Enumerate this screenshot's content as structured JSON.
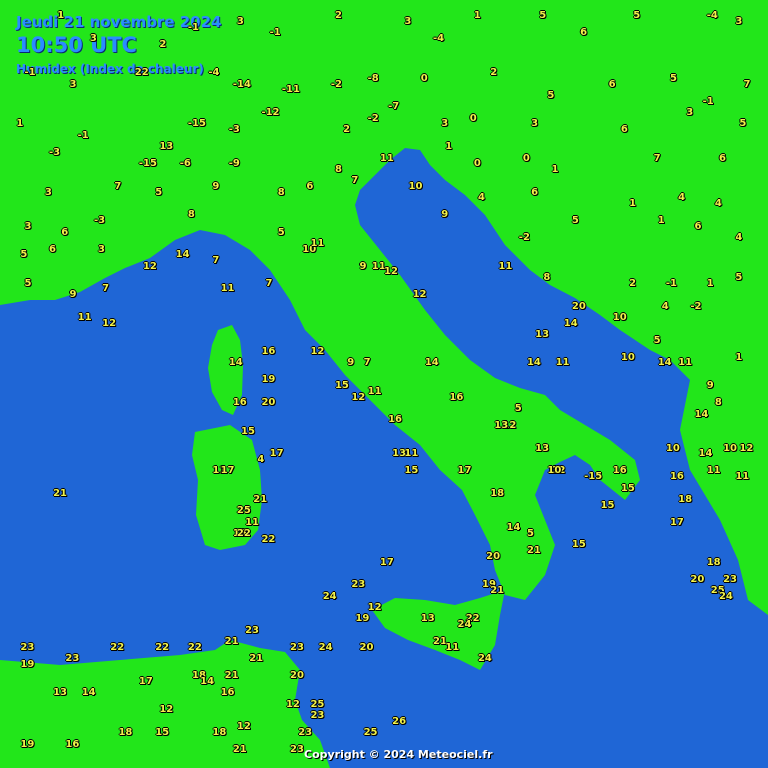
{
  "header": {
    "date": "Jeudi 21 novembre 2024",
    "time": "10:50 UTC",
    "product": "Humidex (Index de chaleur)"
  },
  "copyright": "Copyright © 2024 Meteociel.fr",
  "colors": {
    "sea": "#1f66d6",
    "land": "#22e61a",
    "value_text": "#f2f24a",
    "header_text": "#2a8cff"
  },
  "stations": [
    {
      "v": "1",
      "lon": 4.4,
      "lat": 47.9
    },
    {
      "v": "3",
      "lon": 5.2,
      "lat": 47.5
    },
    {
      "v": "2",
      "lon": 6.9,
      "lat": 47.4
    },
    {
      "v": "-1",
      "lon": 7.6,
      "lat": 47.7
    },
    {
      "v": "3",
      "lon": 8.8,
      "lat": 47.8
    },
    {
      "v": "-1",
      "lon": 9.6,
      "lat": 47.6
    },
    {
      "v": "2",
      "lon": 11.2,
      "lat": 47.9
    },
    {
      "v": "3",
      "lon": 12.9,
      "lat": 47.8
    },
    {
      "v": "-4",
      "lon": 13.6,
      "lat": 47.5
    },
    {
      "v": "1",
      "lon": 14.6,
      "lat": 47.9
    },
    {
      "v": "5",
      "lon": 16.2,
      "lat": 47.9
    },
    {
      "v": "6",
      "lon": 17.2,
      "lat": 47.6
    },
    {
      "v": "5",
      "lon": 18.5,
      "lat": 47.9
    },
    {
      "v": "-4",
      "lon": 20.3,
      "lat": 47.9
    },
    {
      "v": "3",
      "lon": 21.0,
      "lat": 47.8
    },
    {
      "v": "-1",
      "lon": 3.6,
      "lat": 46.9
    },
    {
      "v": "3",
      "lon": 4.7,
      "lat": 46.7
    },
    {
      "v": "22",
      "lon": 6.3,
      "lat": 46.9
    },
    {
      "v": "-4",
      "lon": 8.1,
      "lat": 46.9
    },
    {
      "v": "-14",
      "lon": 8.7,
      "lat": 46.7
    },
    {
      "v": "-11",
      "lon": 9.9,
      "lat": 46.6
    },
    {
      "v": "-2",
      "lon": 11.1,
      "lat": 46.7
    },
    {
      "v": "-8",
      "lon": 12.0,
      "lat": 46.8
    },
    {
      "v": "0",
      "lon": 13.3,
      "lat": 46.8
    },
    {
      "v": "2",
      "lon": 15.0,
      "lat": 46.9
    },
    {
      "v": "5",
      "lon": 16.4,
      "lat": 46.5
    },
    {
      "v": "6",
      "lon": 17.9,
      "lat": 46.7
    },
    {
      "v": "5",
      "lon": 19.4,
      "lat": 46.8
    },
    {
      "v": "-1",
      "lon": 20.2,
      "lat": 46.4
    },
    {
      "v": "7",
      "lon": 21.2,
      "lat": 46.7
    },
    {
      "v": "1",
      "lon": 3.4,
      "lat": 46.0
    },
    {
      "v": "-1",
      "lon": 4.9,
      "lat": 45.8
    },
    {
      "v": "13",
      "lon": 6.9,
      "lat": 45.6
    },
    {
      "v": "-15",
      "lon": 7.6,
      "lat": 46.0
    },
    {
      "v": "-3",
      "lon": 8.6,
      "lat": 45.9
    },
    {
      "v": "-12",
      "lon": 9.4,
      "lat": 46.2
    },
    {
      "v": "2",
      "lon": 11.4,
      "lat": 45.9
    },
    {
      "v": "-2",
      "lon": 12.0,
      "lat": 46.1
    },
    {
      "v": "-7",
      "lon": 12.5,
      "lat": 46.3
    },
    {
      "v": "3",
      "lon": 13.8,
      "lat": 46.0
    },
    {
      "v": "0",
      "lon": 14.5,
      "lat": 46.1
    },
    {
      "v": "3",
      "lon": 16.0,
      "lat": 46.0
    },
    {
      "v": "6",
      "lon": 18.2,
      "lat": 45.9
    },
    {
      "v": "3",
      "lon": 19.8,
      "lat": 46.2
    },
    {
      "v": "5",
      "lon": 21.1,
      "lat": 46.0
    },
    {
      "v": "-3",
      "lon": 4.2,
      "lat": 45.5
    },
    {
      "v": "-15",
      "lon": 6.4,
      "lat": 45.3
    },
    {
      "v": "-6",
      "lon": 7.4,
      "lat": 45.3
    },
    {
      "v": "-9",
      "lon": 8.6,
      "lat": 45.3
    },
    {
      "v": "8",
      "lon": 11.2,
      "lat": 45.2
    },
    {
      "v": "11",
      "lon": 12.3,
      "lat": 45.4
    },
    {
      "v": "1",
      "lon": 13.9,
      "lat": 45.6
    },
    {
      "v": "0",
      "lon": 14.6,
      "lat": 45.3
    },
    {
      "v": "0",
      "lon": 15.8,
      "lat": 45.4
    },
    {
      "v": "1",
      "lon": 16.5,
      "lat": 45.2
    },
    {
      "v": "7",
      "lon": 19.0,
      "lat": 45.4
    },
    {
      "v": "6",
      "lon": 20.6,
      "lat": 45.4
    },
    {
      "v": "3",
      "lon": 4.1,
      "lat": 44.8
    },
    {
      "v": "7",
      "lon": 5.8,
      "lat": 44.9
    },
    {
      "v": "5",
      "lon": 6.8,
      "lat": 44.8
    },
    {
      "v": "9",
      "lon": 8.2,
      "lat": 44.9
    },
    {
      "v": "8",
      "lon": 9.8,
      "lat": 44.8
    },
    {
      "v": "6",
      "lon": 10.5,
      "lat": 44.9
    },
    {
      "v": "7",
      "lon": 11.6,
      "lat": 45.0
    },
    {
      "v": "10",
      "lon": 13.0,
      "lat": 44.9
    },
    {
      "v": "4",
      "lon": 14.7,
      "lat": 44.7
    },
    {
      "v": "6",
      "lon": 16.0,
      "lat": 44.8
    },
    {
      "v": "1",
      "lon": 18.4,
      "lat": 44.6
    },
    {
      "v": "4",
      "lon": 19.6,
      "lat": 44.7
    },
    {
      "v": "4",
      "lon": 20.5,
      "lat": 44.6
    },
    {
      "v": "3",
      "lon": 3.6,
      "lat": 44.2
    },
    {
      "v": "6",
      "lon": 4.5,
      "lat": 44.1
    },
    {
      "v": "-3",
      "lon": 5.3,
      "lat": 44.3
    },
    {
      "v": "8",
      "lon": 7.6,
      "lat": 44.4
    },
    {
      "v": "5",
      "lon": 9.8,
      "lat": 44.1
    },
    {
      "v": "9",
      "lon": 13.8,
      "lat": 44.4
    },
    {
      "v": "-2",
      "lon": 15.7,
      "lat": 44.0
    },
    {
      "v": "5",
      "lon": 17.0,
      "lat": 44.3
    },
    {
      "v": "1",
      "lon": 19.1,
      "lat": 44.3
    },
    {
      "v": "6",
      "lon": 20.0,
      "lat": 44.2
    },
    {
      "v": "4",
      "lon": 21.0,
      "lat": 44.0
    },
    {
      "v": "5",
      "lon": 3.5,
      "lat": 43.7
    },
    {
      "v": "6",
      "lon": 4.2,
      "lat": 43.8
    },
    {
      "v": "3",
      "lon": 5.4,
      "lat": 43.8
    },
    {
      "v": "14",
      "lon": 7.3,
      "lat": 43.7
    },
    {
      "v": "7",
      "lon": 8.2,
      "lat": 43.6
    },
    {
      "v": "10",
      "lon": 10.4,
      "lat": 43.8
    },
    {
      "v": "11",
      "lon": 10.6,
      "lat": 43.9
    },
    {
      "v": "9",
      "lon": 11.8,
      "lat": 43.5
    },
    {
      "v": "11",
      "lon": 12.1,
      "lat": 43.5
    },
    {
      "v": "11",
      "lon": 15.2,
      "lat": 43.5
    },
    {
      "v": "2",
      "lon": 18.4,
      "lat": 43.2
    },
    {
      "v": "-1",
      "lon": 19.3,
      "lat": 43.2
    },
    {
      "v": "1",
      "lon": 20.3,
      "lat": 43.2
    },
    {
      "v": "5",
      "lon": 21.0,
      "lat": 43.3
    },
    {
      "v": "5",
      "lon": 3.6,
      "lat": 43.2
    },
    {
      "v": "9",
      "lon": 4.7,
      "lat": 43.0
    },
    {
      "v": "7",
      "lon": 5.5,
      "lat": 43.1
    },
    {
      "v": "12",
      "lon": 6.5,
      "lat": 43.5
    },
    {
      "v": "11",
      "lon": 8.4,
      "lat": 43.1
    },
    {
      "v": "7",
      "lon": 9.5,
      "lat": 43.2
    },
    {
      "v": "12",
      "lon": 12.4,
      "lat": 43.4
    },
    {
      "v": "12",
      "lon": 13.1,
      "lat": 43.0
    },
    {
      "v": "8",
      "lon": 16.3,
      "lat": 43.3
    },
    {
      "v": "20",
      "lon": 17.0,
      "lat": 42.8
    },
    {
      "v": "4",
      "lon": 19.2,
      "lat": 42.8
    },
    {
      "v": "-2",
      "lon": 19.9,
      "lat": 42.8
    },
    {
      "v": "11",
      "lon": 4.9,
      "lat": 42.6
    },
    {
      "v": "12",
      "lon": 5.5,
      "lat": 42.5
    },
    {
      "v": "13",
      "lon": 16.1,
      "lat": 42.3
    },
    {
      "v": "14",
      "lon": 16.8,
      "lat": 42.5
    },
    {
      "v": "10",
      "lon": 18.0,
      "lat": 42.6
    },
    {
      "v": "5",
      "lon": 19.0,
      "lat": 42.2
    },
    {
      "v": "14",
      "lon": 8.6,
      "lat": 41.8
    },
    {
      "v": "16",
      "lon": 9.4,
      "lat": 42.0
    },
    {
      "v": "12",
      "lon": 10.6,
      "lat": 42.0
    },
    {
      "v": "9",
      "lon": 11.5,
      "lat": 41.8
    },
    {
      "v": "7",
      "lon": 11.9,
      "lat": 41.8
    },
    {
      "v": "14",
      "lon": 13.4,
      "lat": 41.8
    },
    {
      "v": "14",
      "lon": 15.9,
      "lat": 41.8
    },
    {
      "v": "11",
      "lon": 16.6,
      "lat": 41.8
    },
    {
      "v": "10",
      "lon": 18.2,
      "lat": 41.9
    },
    {
      "v": "14",
      "lon": 19.1,
      "lat": 41.8
    },
    {
      "v": "11",
      "lon": 19.6,
      "lat": 41.8
    },
    {
      "v": "1",
      "lon": 21.0,
      "lat": 41.9
    },
    {
      "v": "19",
      "lon": 9.4,
      "lat": 41.5
    },
    {
      "v": "16",
      "lon": 8.7,
      "lat": 41.1
    },
    {
      "v": "20",
      "lon": 9.4,
      "lat": 41.1
    },
    {
      "v": "15",
      "lon": 11.2,
      "lat": 41.4
    },
    {
      "v": "12",
      "lon": 11.6,
      "lat": 41.2
    },
    {
      "v": "11",
      "lon": 12.0,
      "lat": 41.3
    },
    {
      "v": "16",
      "lon": 14.0,
      "lat": 41.2
    },
    {
      "v": "5",
      "lon": 15.6,
      "lat": 41.0
    },
    {
      "v": "9",
      "lon": 20.3,
      "lat": 41.4
    },
    {
      "v": "15",
      "lon": 8.9,
      "lat": 40.6
    },
    {
      "v": "16",
      "lon": 12.5,
      "lat": 40.8
    },
    {
      "v": "12",
      "lon": 15.3,
      "lat": 40.7
    },
    {
      "v": "13",
      "lon": 15.1,
      "lat": 40.7
    },
    {
      "v": "14",
      "lon": 20.0,
      "lat": 40.9
    },
    {
      "v": "8",
      "lon": 20.5,
      "lat": 41.1
    },
    {
      "v": "4",
      "lon": 9.3,
      "lat": 40.1
    },
    {
      "v": "17",
      "lon": 9.6,
      "lat": 40.2
    },
    {
      "v": "13",
      "lon": 12.6,
      "lat": 40.2
    },
    {
      "v": "11",
      "lon": 12.9,
      "lat": 40.2
    },
    {
      "v": "15",
      "lon": 12.9,
      "lat": 39.9
    },
    {
      "v": "17",
      "lon": 14.2,
      "lat": 39.9
    },
    {
      "v": "13",
      "lon": 16.1,
      "lat": 40.3
    },
    {
      "v": "12",
      "lon": 16.5,
      "lat": 39.9
    },
    {
      "v": "10",
      "lon": 16.4,
      "lat": 39.9
    },
    {
      "v": "-15",
      "lon": 17.3,
      "lat": 39.8
    },
    {
      "v": "16",
      "lon": 18.0,
      "lat": 39.9
    },
    {
      "v": "10",
      "lon": 19.3,
      "lat": 40.3
    },
    {
      "v": "14",
      "lon": 20.1,
      "lat": 40.2
    },
    {
      "v": "10",
      "lon": 20.7,
      "lat": 40.3
    },
    {
      "v": "12",
      "lon": 21.1,
      "lat": 40.3
    },
    {
      "v": "11",
      "lon": 8.2,
      "lat": 39.9
    },
    {
      "v": "17",
      "lon": 8.4,
      "lat": 39.9
    },
    {
      "v": "15",
      "lon": 18.2,
      "lat": 39.6
    },
    {
      "v": "16",
      "lon": 19.4,
      "lat": 39.8
    },
    {
      "v": "11",
      "lon": 20.3,
      "lat": 39.9
    },
    {
      "v": "11",
      "lon": 21.0,
      "lat": 39.8
    },
    {
      "v": "21",
      "lon": 4.3,
      "lat": 39.5
    },
    {
      "v": "21",
      "lon": 9.2,
      "lat": 39.4
    },
    {
      "v": "25",
      "lon": 8.8,
      "lat": 39.2
    },
    {
      "v": "11",
      "lon": 9.0,
      "lat": 39.0
    },
    {
      "v": "19",
      "lon": 8.7,
      "lat": 38.8
    },
    {
      "v": "22",
      "lon": 8.8,
      "lat": 38.8
    },
    {
      "v": "22",
      "lon": 9.4,
      "lat": 38.7
    },
    {
      "v": "18",
      "lon": 15.0,
      "lat": 39.5
    },
    {
      "v": "15",
      "lon": 17.7,
      "lat": 39.3
    },
    {
      "v": "18",
      "lon": 19.6,
      "lat": 39.4
    },
    {
      "v": "17",
      "lon": 19.4,
      "lat": 39.0
    },
    {
      "v": "14",
      "lon": 15.4,
      "lat": 38.9
    },
    {
      "v": "5",
      "lon": 15.9,
      "lat": 38.8
    },
    {
      "v": "15",
      "lon": 17.0,
      "lat": 38.6
    },
    {
      "v": "21",
      "lon": 15.9,
      "lat": 38.5
    },
    {
      "v": "20",
      "lon": 14.9,
      "lat": 38.4
    },
    {
      "v": "17",
      "lon": 12.3,
      "lat": 38.3
    },
    {
      "v": "23",
      "lon": 11.6,
      "lat": 37.9
    },
    {
      "v": "24",
      "lon": 10.9,
      "lat": 37.7
    },
    {
      "v": "12",
      "lon": 12.0,
      "lat": 37.5
    },
    {
      "v": "19",
      "lon": 11.7,
      "lat": 37.3
    },
    {
      "v": "13",
      "lon": 13.3,
      "lat": 37.3
    },
    {
      "v": "19",
      "lon": 14.8,
      "lat": 37.9
    },
    {
      "v": "21",
      "lon": 15.0,
      "lat": 37.8
    },
    {
      "v": "22",
      "lon": 14.4,
      "lat": 37.3
    },
    {
      "v": "24",
      "lon": 14.2,
      "lat": 37.2
    },
    {
      "v": "21",
      "lon": 13.6,
      "lat": 36.9
    },
    {
      "v": "11",
      "lon": 13.9,
      "lat": 36.8
    },
    {
      "v": "24",
      "lon": 14.7,
      "lat": 36.6
    },
    {
      "v": "18",
      "lon": 20.3,
      "lat": 38.3
    },
    {
      "v": "20",
      "lon": 19.9,
      "lat": 38.0
    },
    {
      "v": "25",
      "lon": 20.4,
      "lat": 37.8
    },
    {
      "v": "24",
      "lon": 20.6,
      "lat": 37.7
    },
    {
      "v": "23",
      "lon": 20.7,
      "lat": 38.0
    },
    {
      "v": "23",
      "lon": 3.5,
      "lat": 36.8
    },
    {
      "v": "23",
      "lon": 4.6,
      "lat": 36.6
    },
    {
      "v": "22",
      "lon": 5.7,
      "lat": 36.8
    },
    {
      "v": "22",
      "lon": 6.8,
      "lat": 36.8
    },
    {
      "v": "22",
      "lon": 7.6,
      "lat": 36.8
    },
    {
      "v": "21",
      "lon": 8.5,
      "lat": 36.9
    },
    {
      "v": "23",
      "lon": 9.0,
      "lat": 37.1
    },
    {
      "v": "23",
      "lon": 10.1,
      "lat": 36.8
    },
    {
      "v": "24",
      "lon": 10.8,
      "lat": 36.8
    },
    {
      "v": "20",
      "lon": 11.8,
      "lat": 36.8
    },
    {
      "v": "21",
      "lon": 9.1,
      "lat": 36.6
    },
    {
      "v": "19",
      "lon": 3.5,
      "lat": 36.5
    },
    {
      "v": "20",
      "lon": 10.1,
      "lat": 36.3
    },
    {
      "v": "17",
      "lon": 6.4,
      "lat": 36.2
    },
    {
      "v": "18",
      "lon": 7.7,
      "lat": 36.3
    },
    {
      "v": "21",
      "lon": 8.5,
      "lat": 36.3
    },
    {
      "v": "14",
      "lon": 7.9,
      "lat": 36.2
    },
    {
      "v": "13",
      "lon": 4.3,
      "lat": 36.0
    },
    {
      "v": "14",
      "lon": 5.0,
      "lat": 36.0
    },
    {
      "v": "16",
      "lon": 8.4,
      "lat": 36.0
    },
    {
      "v": "12",
      "lon": 6.9,
      "lat": 35.7
    },
    {
      "v": "12",
      "lon": 10.0,
      "lat": 35.8
    },
    {
      "v": "25",
      "lon": 10.6,
      "lat": 35.8
    },
    {
      "v": "23",
      "lon": 10.6,
      "lat": 35.6
    },
    {
      "v": "26",
      "lon": 12.6,
      "lat": 35.5
    },
    {
      "v": "18",
      "lon": 5.9,
      "lat": 35.3
    },
    {
      "v": "15",
      "lon": 6.8,
      "lat": 35.3
    },
    {
      "v": "18",
      "lon": 8.2,
      "lat": 35.3
    },
    {
      "v": "12",
      "lon": 8.8,
      "lat": 35.4
    },
    {
      "v": "23",
      "lon": 10.3,
      "lat": 35.3
    },
    {
      "v": "25",
      "lon": 11.9,
      "lat": 35.3
    },
    {
      "v": "19",
      "lon": 3.5,
      "lat": 35.1
    },
    {
      "v": "16",
      "lon": 4.6,
      "lat": 35.1
    },
    {
      "v": "21",
      "lon": 8.7,
      "lat": 35.0
    },
    {
      "v": "23",
      "lon": 10.1,
      "lat": 35.0
    }
  ]
}
